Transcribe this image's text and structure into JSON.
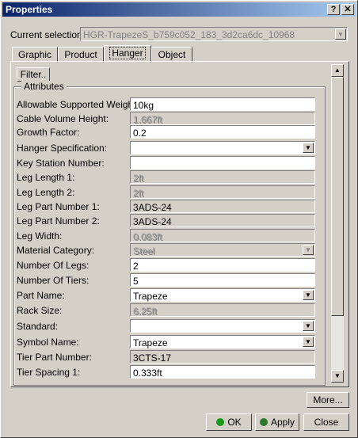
{
  "window": {
    "title": "Properties",
    "help_label": "?",
    "close_label": "✕"
  },
  "selection": {
    "label": "Current selection :",
    "value": "HGR-TrapezeS_b759c052_183_3d2ca6dc_10968"
  },
  "tabs": [
    {
      "label": "Graphic"
    },
    {
      "label": "Product"
    },
    {
      "label": "Hanger"
    },
    {
      "label": "Object"
    }
  ],
  "filter_label": "Filter..",
  "attributes_title": "Attributes",
  "rows": [
    {
      "label": "Allowable Supported Weight:",
      "value": "10kg",
      "state": "edit"
    },
    {
      "label": "Cable Volume Height:",
      "value": "1.667ft",
      "state": "disabled"
    },
    {
      "label": "Growth Factor:",
      "value": "0.2",
      "state": "edit"
    },
    {
      "label": "Hanger Specification:",
      "value": "",
      "state": "dropdown"
    },
    {
      "label": "Key Station Number:",
      "value": "",
      "state": "edit"
    },
    {
      "label": "Leg Length 1:",
      "value": "2ft",
      "state": "disabled"
    },
    {
      "label": "Leg Length 2:",
      "value": "2ft",
      "state": "disabled"
    },
    {
      "label": "Leg Part Number 1:",
      "value": "3ADS-24",
      "state": "readonly"
    },
    {
      "label": "Leg Part Number 2:",
      "value": "3ADS-24",
      "state": "readonly"
    },
    {
      "label": "Leg Width:",
      "value": "0.083ft",
      "state": "disabled"
    },
    {
      "label": "Material Category:",
      "value": "Steel",
      "state": "dropdown-disabled"
    },
    {
      "label": "Number Of Legs:",
      "value": "2",
      "state": "edit"
    },
    {
      "label": "Number Of Tiers:",
      "value": "5",
      "state": "edit"
    },
    {
      "label": "Part Name:",
      "value": "Trapeze",
      "state": "dropdown"
    },
    {
      "label": "Rack Size:",
      "value": "6.25ft",
      "state": "disabled"
    },
    {
      "label": "Standard:",
      "value": "",
      "state": "dropdown"
    },
    {
      "label": "Symbol Name:",
      "value": "Trapeze",
      "state": "dropdown"
    },
    {
      "label": "Tier Part Number:",
      "value": "3CTS-17",
      "state": "readonly"
    },
    {
      "label": "Tier Spacing 1:",
      "value": "0.333ft",
      "state": "edit"
    }
  ],
  "buttons": {
    "more": "More...",
    "ok": "OK",
    "apply": "Apply",
    "close": "Close"
  },
  "icons": {
    "dropdown": "▼",
    "scroll_up": "▲",
    "scroll_down": "▼"
  },
  "colors": {
    "ok_icon": "#1a9a1a",
    "apply_icon": "#2a7a2a",
    "title_start": "#0a246a",
    "title_end": "#a6caf0"
  }
}
